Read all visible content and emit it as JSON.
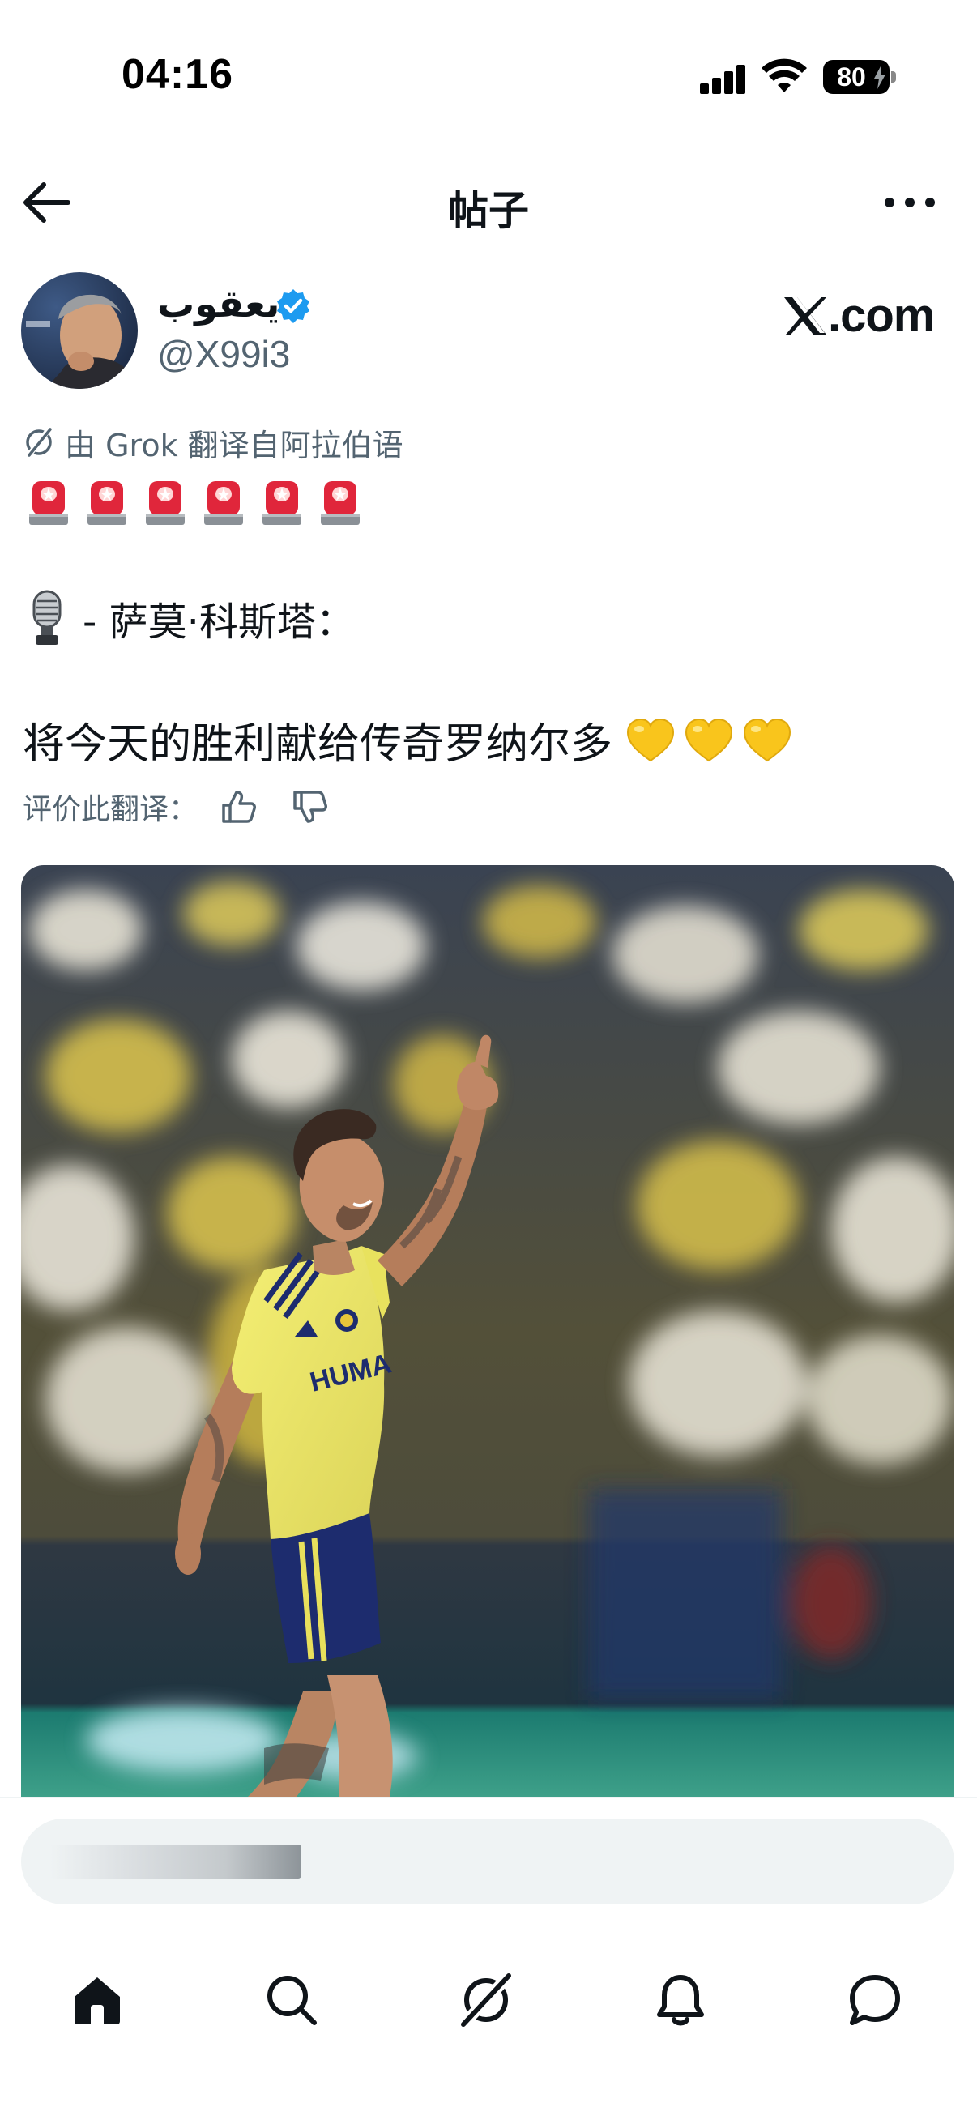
{
  "status_bar": {
    "time": "04:16",
    "battery": "80"
  },
  "header": {
    "title": "帖子",
    "back_icon": "arrow-left-icon",
    "more_icon": "more-horizontal-icon"
  },
  "post": {
    "author_name": "يعقوب",
    "author_handle": "@X99i3",
    "source_label": ".com",
    "translation_note": "由 Grok 翻译自阿拉伯语",
    "siren_count": 6,
    "line1": "- 萨莫·科斯塔：",
    "line2": "将今天的胜利献给传奇罗纳尔多",
    "heart_count": 3,
    "rate_label": "评价此翻译："
  },
  "composer": {
    "placeholder": ""
  },
  "tabbar": {
    "items": [
      "home-icon",
      "search-icon",
      "grok-icon",
      "notifications-icon",
      "messages-icon"
    ]
  },
  "colors": {
    "accent": "#1d9bf0",
    "text_primary": "#0f1419",
    "text_secondary": "#536471",
    "heart_yellow": "#f9c51c",
    "siren_red": "#e0263b",
    "jersey_yellow": "#f0ea6a",
    "shorts_navy": "#1d2c6e"
  }
}
